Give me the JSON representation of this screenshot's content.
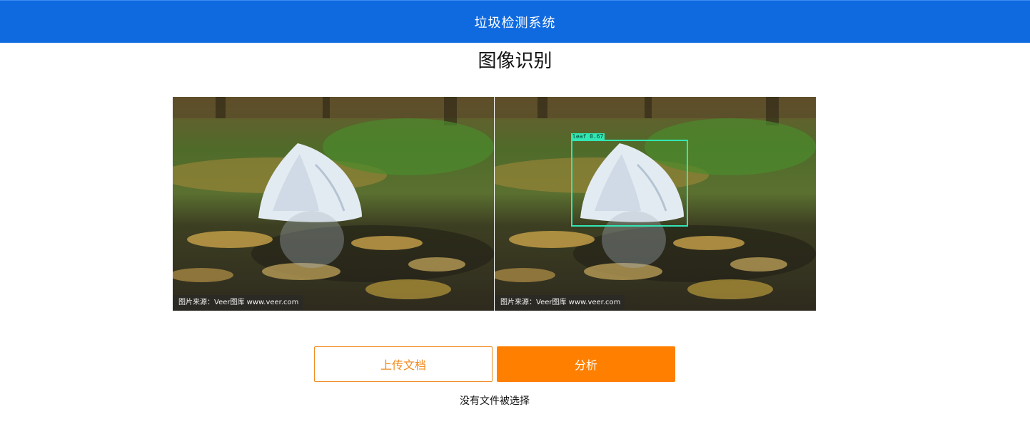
{
  "header": {
    "title": "垃圾检测系统"
  },
  "page": {
    "title": "图像识别"
  },
  "images": {
    "original": {
      "watermark": "图片来源：Veer图库 www.veer.com"
    },
    "result": {
      "watermark": "图片来源：Veer图库 www.veer.com",
      "detection": {
        "label": "leaf 0.67",
        "class": "leaf",
        "confidence": 0.67
      }
    }
  },
  "actions": {
    "upload_label": "上传文档",
    "analyze_label": "分析"
  },
  "file_status": "没有文件被选择",
  "colors": {
    "header": "#0f6ae0",
    "accent": "#ff8000",
    "detection_box": "#32e6b4"
  }
}
